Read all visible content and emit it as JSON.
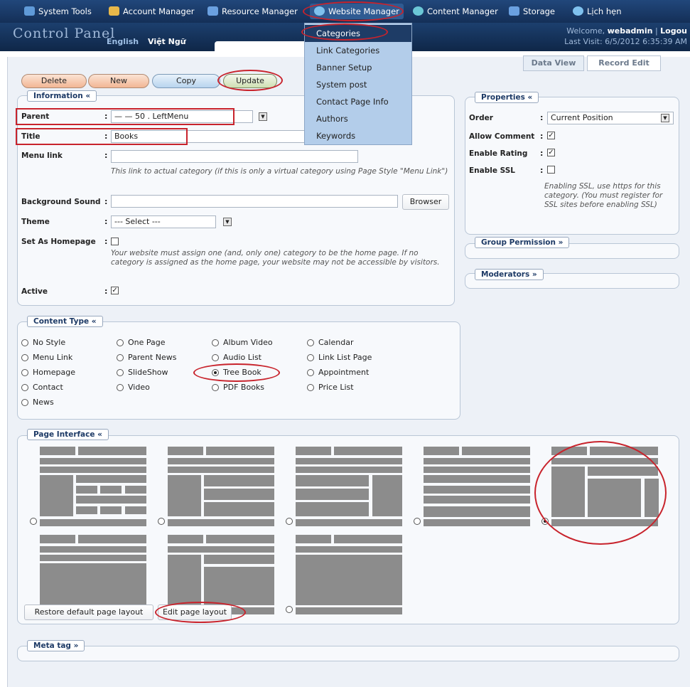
{
  "nav": {
    "items": [
      {
        "label": "System Tools",
        "icon": "tools-icon"
      },
      {
        "label": "Account Manager",
        "icon": "users-icon"
      },
      {
        "label": "Resource Manager",
        "icon": "resource-icon"
      },
      {
        "label": "Website Manager",
        "icon": "globe-icon"
      },
      {
        "label": "Content Manager",
        "icon": "content-icon"
      },
      {
        "label": "Storage",
        "icon": "storage-icon"
      },
      {
        "label": "Lịch hẹn",
        "icon": "calendar-icon"
      }
    ]
  },
  "header": {
    "logo": "Control Panel",
    "lang_en": "English",
    "lang_vi": "Việt Ngữ",
    "welcome_prefix": "Welcome,",
    "username": "webadmin",
    "logout": "Logou",
    "last_visit": "Last Visit: 6/5/2012 6:35:39 AM"
  },
  "dropdown_menu": [
    "Categories",
    "Link Categories",
    "Banner Setup",
    "System post",
    "Contact Page Info",
    "Authors",
    "Keywords"
  ],
  "toolbar": {
    "delete": "Delete",
    "new": "New",
    "copy": "Copy",
    "update": "Update"
  },
  "view_tabs": {
    "data_view": "Data View",
    "record_edit": "Record Edit"
  },
  "information": {
    "legend": "Information «",
    "parent_label": "Parent",
    "parent_value": "— — 50 . LeftMenu",
    "title_label": "Title",
    "title_value": "Books",
    "menu_link_label": "Menu link",
    "menu_link_help": "This link to actual category (if this is only a virtual category using Page Style \"Menu Link\")",
    "bg_sound_label": "Background Sound",
    "browser_button": "Browser",
    "theme_label": "Theme",
    "theme_value": "--- Select ---",
    "homepage_label": "Set As Homepage",
    "homepage_help": "Your website must assign one (and, only one) category to be the home page. If no category is assigned as the home page, your website may not be accessible by visitors.",
    "active_label": "Active",
    "colon": ":"
  },
  "properties": {
    "legend": "Properties «",
    "order_label": "Order",
    "order_value": "Current Position",
    "allow_comment_label": "Allow Comment",
    "enable_rating_label": "Enable Rating",
    "enable_ssl_label": "Enable SSL",
    "ssl_help": "Enabling SSL, use https for this category. (You must register for SSL sites before enabling SSL)"
  },
  "group_permission": {
    "legend": "Group Permission »"
  },
  "moderators": {
    "legend": "Moderators »"
  },
  "content_type": {
    "legend": "Content Type «",
    "options": [
      "No Style",
      "Menu Link",
      "Homepage",
      "Contact",
      "News",
      "One Page",
      "Parent News",
      "SlideShow",
      "Video",
      "Album Video",
      "Audio List",
      "Tree Book",
      "PDF Books",
      "Calendar",
      "Link List Page",
      "Appointment",
      "Price List"
    ],
    "selected": "Tree Book"
  },
  "page_interface": {
    "legend": "Page Interface «",
    "layout_count": 8,
    "selected_index": 5,
    "restore_button": "Restore default page layout",
    "edit_button": "Edit page layout"
  },
  "meta_tag": {
    "legend": "Meta tag »"
  },
  "colors": {
    "nav_bg": "#1a3b69",
    "panel_bg": "#f7f9fc",
    "annotation": "#c8232c",
    "menu_bg": "#b3cdea",
    "menu_selected": "#1e3c66"
  }
}
